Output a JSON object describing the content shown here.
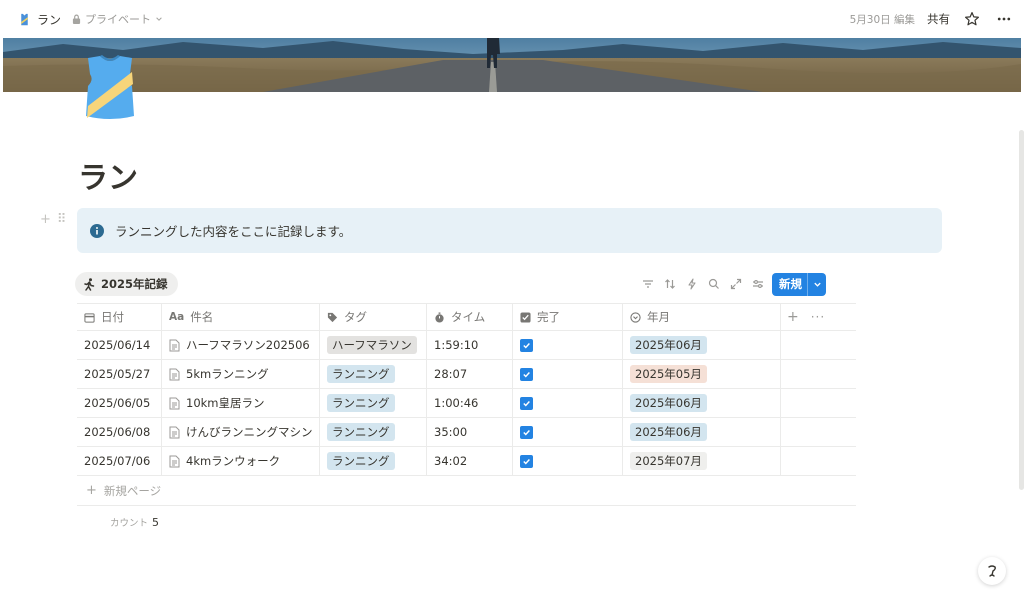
{
  "topbar": {
    "page_title": "ラン",
    "privacy": "プライベート",
    "edited": "5月30日 編集",
    "share": "共有"
  },
  "page": {
    "title": "ラン",
    "callout": "ランニングした内容をここに記録します。"
  },
  "database": {
    "view_name": "2025年記録",
    "new_button": "新規",
    "columns": {
      "date": "日付",
      "name": "件名",
      "tag": "タグ",
      "time": "タイム",
      "done": "完了",
      "month": "年月"
    },
    "rows": [
      {
        "date": "2025/06/14",
        "name": "ハーフマラソン202506",
        "tag": "ハーフマラソン",
        "tag_color": "#e3e2e0",
        "time": "1:59:10",
        "done": true,
        "month": "2025年06月",
        "month_color": "#d3e5ef"
      },
      {
        "date": "2025/05/27",
        "name": "5kmランニング",
        "tag": "ランニング",
        "tag_color": "#d3e5ef",
        "time": "28:07",
        "done": true,
        "month": "2025年05月",
        "month_color": "#f5e0d6"
      },
      {
        "date": "2025/06/05",
        "name": "10km皇居ラン",
        "tag": "ランニング",
        "tag_color": "#d3e5ef",
        "time": "1:00:46",
        "done": true,
        "month": "2025年06月",
        "month_color": "#d3e5ef"
      },
      {
        "date": "2025/06/08",
        "name": "けんびランニングマシン",
        "tag": "ランニング",
        "tag_color": "#d3e5ef",
        "time": "35:00",
        "done": true,
        "month": "2025年06月",
        "month_color": "#d3e5ef"
      },
      {
        "date": "2025/07/06",
        "name": "4kmランウォーク",
        "tag": "ランニング",
        "tag_color": "#d3e5ef",
        "time": "34:02",
        "done": true,
        "month": "2025年07月",
        "month_color": "#efefed"
      }
    ],
    "new_page": "新規ページ",
    "count_label": "カウント",
    "count_value": "5"
  },
  "colors": {
    "accent": "#2383e2",
    "callout_bg": "#e7f1f7",
    "text": "#37352f",
    "muted": "#9b9a97"
  },
  "icons": {
    "page": "running-shirt-icon",
    "callout": "info-icon",
    "view": "runner-icon"
  }
}
